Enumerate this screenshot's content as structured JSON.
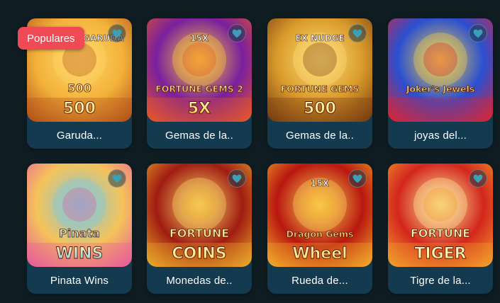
{
  "badge": "Populares",
  "games": [
    {
      "title": "Garuda...",
      "art_top": "FORTUNE GARUDA",
      "art_main": "500",
      "art_sub": "500",
      "palette": [
        "#f3b23a",
        "#b5541a",
        "#ffd86b"
      ]
    },
    {
      "title": "Gemas de la..",
      "art_top": "15X",
      "art_main": "FORTUNE GEMS 2",
      "art_sub": "5X",
      "palette": [
        "#7a1f9e",
        "#e3552a",
        "#ffcf3a"
      ]
    },
    {
      "title": "Gemas de la..",
      "art_top": "EX NUDGE",
      "art_main": "FORTUNE GEMS",
      "art_sub": "500",
      "palette": [
        "#d99a2a",
        "#7a3e12",
        "#ffe07a"
      ]
    },
    {
      "title": "joyas del...",
      "art_top": "",
      "art_main": "Joker's Jewels",
      "art_sub": "",
      "palette": [
        "#2a4fd1",
        "#d4263a",
        "#f5d34a"
      ]
    },
    {
      "title": "Pinata Wins",
      "art_top": "",
      "art_main": "Pinata",
      "art_sub": "WINS",
      "palette": [
        "#f5c35a",
        "#e85f98",
        "#7ec8e0"
      ]
    },
    {
      "title": "Monedas de..",
      "art_top": "",
      "art_main": "FORTUNE",
      "art_sub": "COINS",
      "palette": [
        "#a01c12",
        "#e9a52a",
        "#ffde6b"
      ]
    },
    {
      "title": "Rueda de...",
      "art_top": "15X",
      "art_main": "Dragon Gems",
      "art_sub": "Wheel",
      "palette": [
        "#b8170f",
        "#f0a52a",
        "#ffd95a"
      ]
    },
    {
      "title": "Tigre de la...",
      "art_top": "",
      "art_main": "FORTUNE",
      "art_sub": "TIGER",
      "palette": [
        "#d3261d",
        "#f29c2b",
        "#fff0a0"
      ]
    }
  ]
}
